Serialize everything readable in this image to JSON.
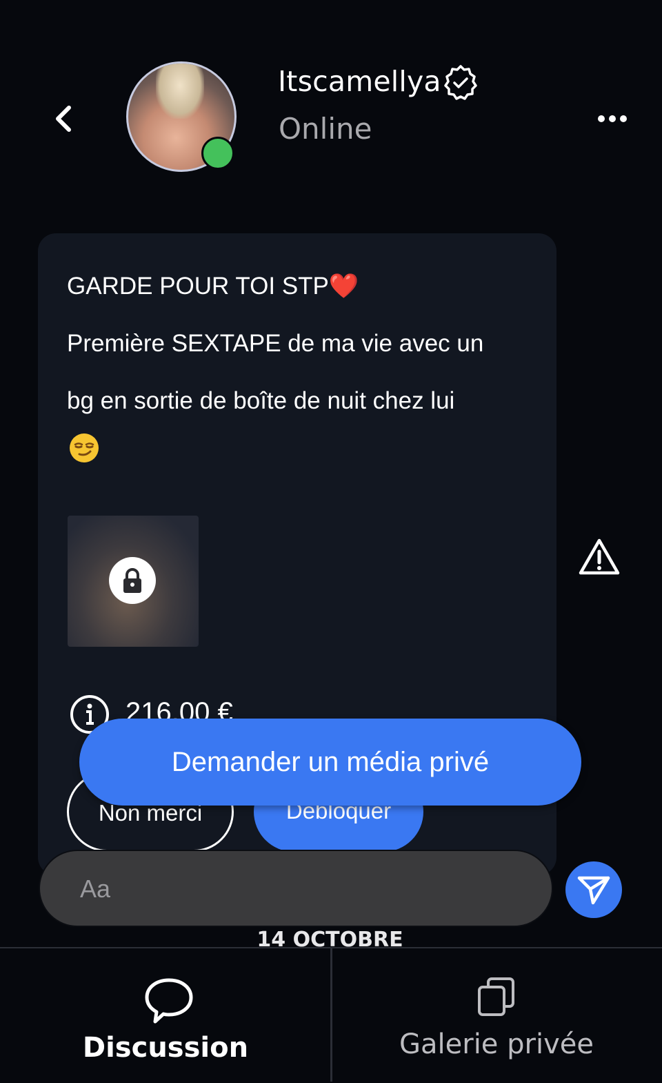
{
  "header": {
    "username": "Itscamellya",
    "status": "Online",
    "icons": [
      "chevron-left-icon",
      "verified-badge-icon",
      "more-options-icon"
    ]
  },
  "message": {
    "title": "GARDE POUR TOI STP❤️",
    "line1": "Première SEXTAPE de ma vie avec un",
    "line2": "bg en sortie de boîte de nuit chez lui",
    "emoji": "😏",
    "media": {
      "locked": true,
      "icon": "lock-icon"
    },
    "price": "216,00 €",
    "actions": {
      "decline": "Non merci",
      "unlock": "Débloquer"
    }
  },
  "request_button": "Demander un média privé",
  "composer": {
    "placeholder": "Aa",
    "send_icon": "send-icon"
  },
  "date_separator": "14 OCTOBRE",
  "tabs": [
    {
      "label": "Discussion",
      "icon": "chat-bubble-icon",
      "active": true
    },
    {
      "label": "Galerie privée",
      "icon": "gallery-icon",
      "active": false
    }
  ],
  "colors": {
    "accent": "#3a78f2",
    "online": "#44c15b",
    "background": "#06080d",
    "card": "#121721"
  }
}
